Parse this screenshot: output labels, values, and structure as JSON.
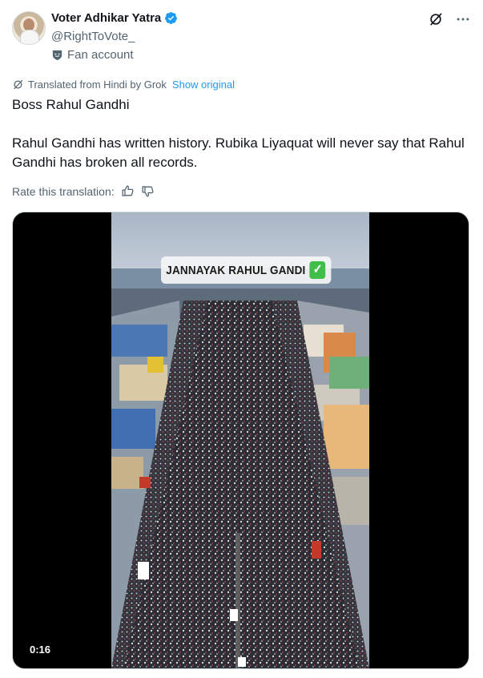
{
  "account": {
    "display_name": "Voter Adhikar Yatra",
    "handle": "@RightToVote_",
    "label": "Fan account"
  },
  "translation": {
    "note": "Translated from Hindi by Grok",
    "show_original": "Show original",
    "rate_label": "Rate this translation:"
  },
  "tweet": {
    "line1": "Boss Rahul Gandhi",
    "line2": "Rahul Gandhi has written history. Rubika Liyaquat will never say that Rahul Gandhi has broken all records."
  },
  "media": {
    "overlay_text": "JANNAYAK RAHUL GANDI",
    "overlay_emoji": "✅",
    "duration": "0:16"
  },
  "icons": {
    "verified": "verified-badge-icon",
    "grok": "grok-icon",
    "more": "more-icon",
    "fan": "fan-badge-icon",
    "thumbs_up": "thumbs-up-icon",
    "thumbs_down": "thumbs-down-icon"
  },
  "colors": {
    "accent": "#1d9bf0",
    "secondary_text": "#536471",
    "primary_text": "#0f1419"
  }
}
